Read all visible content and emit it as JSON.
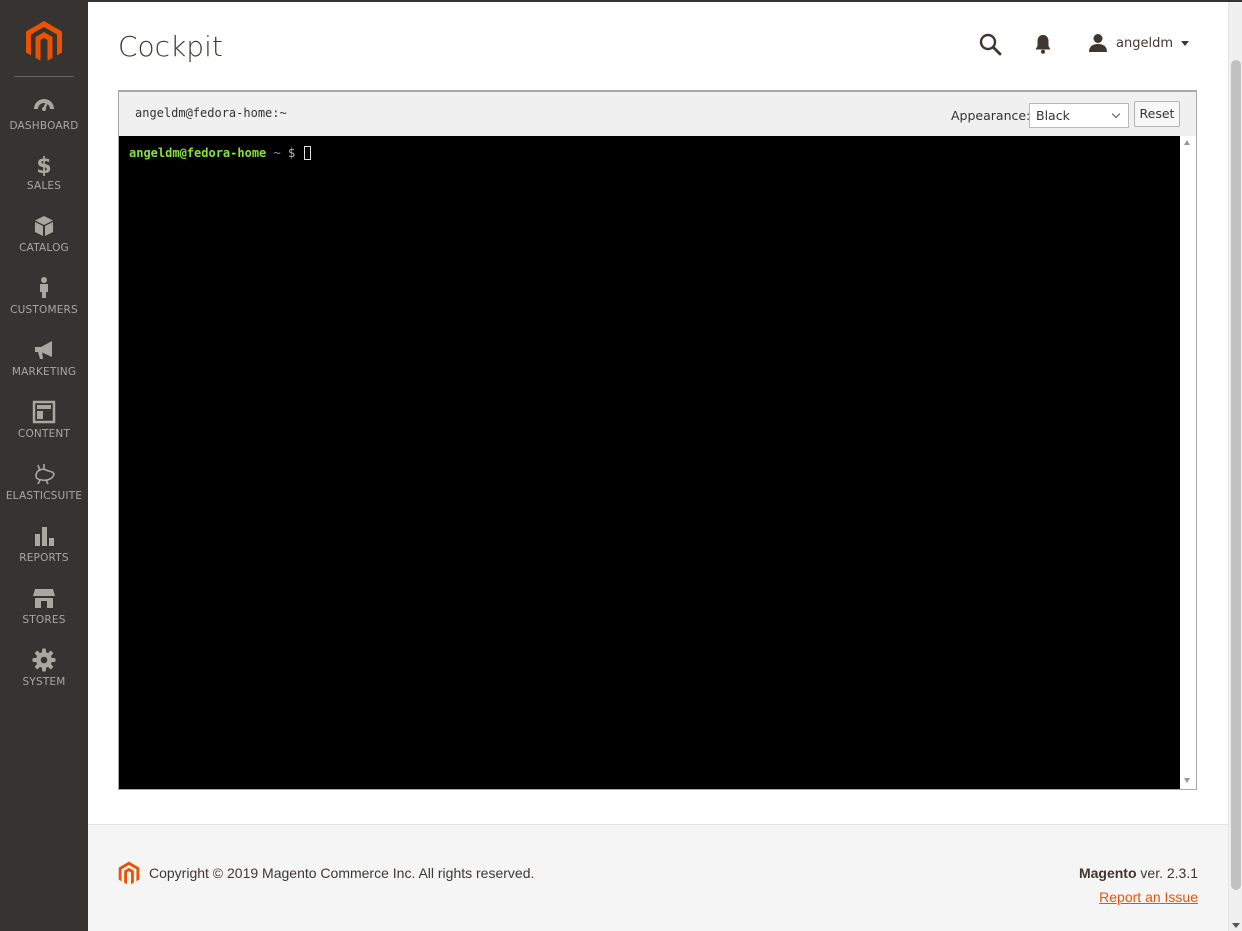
{
  "sidebar": {
    "logo": "magento-logo",
    "items": [
      {
        "label": "DASHBOARD",
        "icon": "dashboard-gauge-icon"
      },
      {
        "label": "SALES",
        "icon": "dollar-icon"
      },
      {
        "label": "CATALOG",
        "icon": "box-icon"
      },
      {
        "label": "CUSTOMERS",
        "icon": "person-icon"
      },
      {
        "label": "MARKETING",
        "icon": "megaphone-icon"
      },
      {
        "label": "CONTENT",
        "icon": "layout-icon"
      },
      {
        "label": "ELASTICSUITE",
        "icon": "elasticsuite-icon"
      },
      {
        "label": "REPORTS",
        "icon": "bar-chart-icon"
      },
      {
        "label": "STORES",
        "icon": "storefront-icon"
      },
      {
        "label": "SYSTEM",
        "icon": "gear-icon"
      }
    ]
  },
  "header": {
    "title": "Cockpit",
    "username": "angeldm"
  },
  "cockpit": {
    "host": "angeldm@fedora-home:~",
    "appearance_label": "Appearance:",
    "appearance_value": "Black",
    "reset_label": "Reset",
    "prompt_user": "angeldm@fedora-home",
    "prompt_path": "~",
    "prompt_symbol": "$"
  },
  "footer": {
    "copyright": "Copyright © 2019 Magento Commerce Inc. All rights reserved.",
    "brand": "Magento",
    "version": "ver. 2.3.1",
    "report": "Report an Issue"
  },
  "colors": {
    "sidebar_bg": "#373330",
    "accent": "#eb5202",
    "terminal_bg": "#000000",
    "prompt_green": "#8ae234"
  }
}
